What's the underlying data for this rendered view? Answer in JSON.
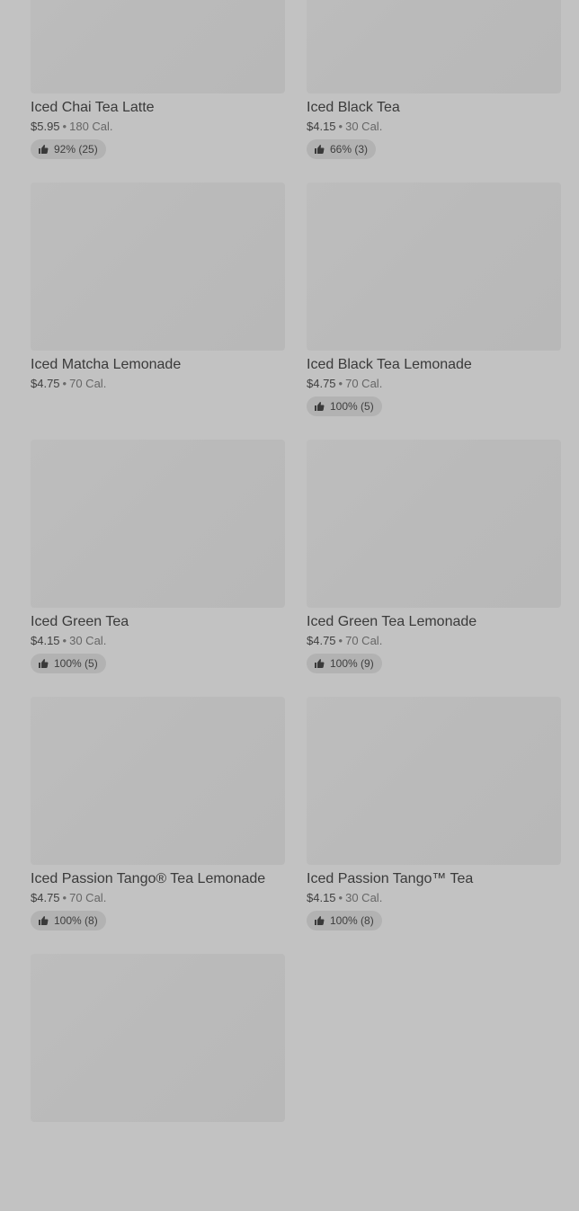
{
  "products": [
    {
      "name": "Iced Chai Tea Latte",
      "price": "$5.95",
      "calories": "180 Cal.",
      "rating": "92% (25)"
    },
    {
      "name": "Iced Black Tea",
      "price": "$4.15",
      "calories": "30 Cal.",
      "rating": "66% (3)"
    },
    {
      "name": "Iced Matcha Lemonade",
      "price": "$4.75",
      "calories": "70 Cal.",
      "rating": null
    },
    {
      "name": "Iced Black Tea Lemonade",
      "price": "$4.75",
      "calories": "70 Cal.",
      "rating": "100% (5)"
    },
    {
      "name": "Iced Green Tea",
      "price": "$4.15",
      "calories": "30 Cal.",
      "rating": "100% (5)"
    },
    {
      "name": "Iced Green Tea Lemonade",
      "price": "$4.75",
      "calories": "70 Cal.",
      "rating": "100% (9)"
    },
    {
      "name": "Iced Passion Tango® Tea Lemonade",
      "price": "$4.75",
      "calories": "70 Cal.",
      "rating": "100% (8)"
    },
    {
      "name": "Iced Passion Tango™ Tea",
      "price": "$4.15",
      "calories": "30 Cal.",
      "rating": "100% (8)"
    },
    {
      "name": "",
      "price": "",
      "calories": "",
      "rating": null
    }
  ],
  "separator": "•",
  "icons": {
    "rating": "thumbs-up-icon"
  }
}
